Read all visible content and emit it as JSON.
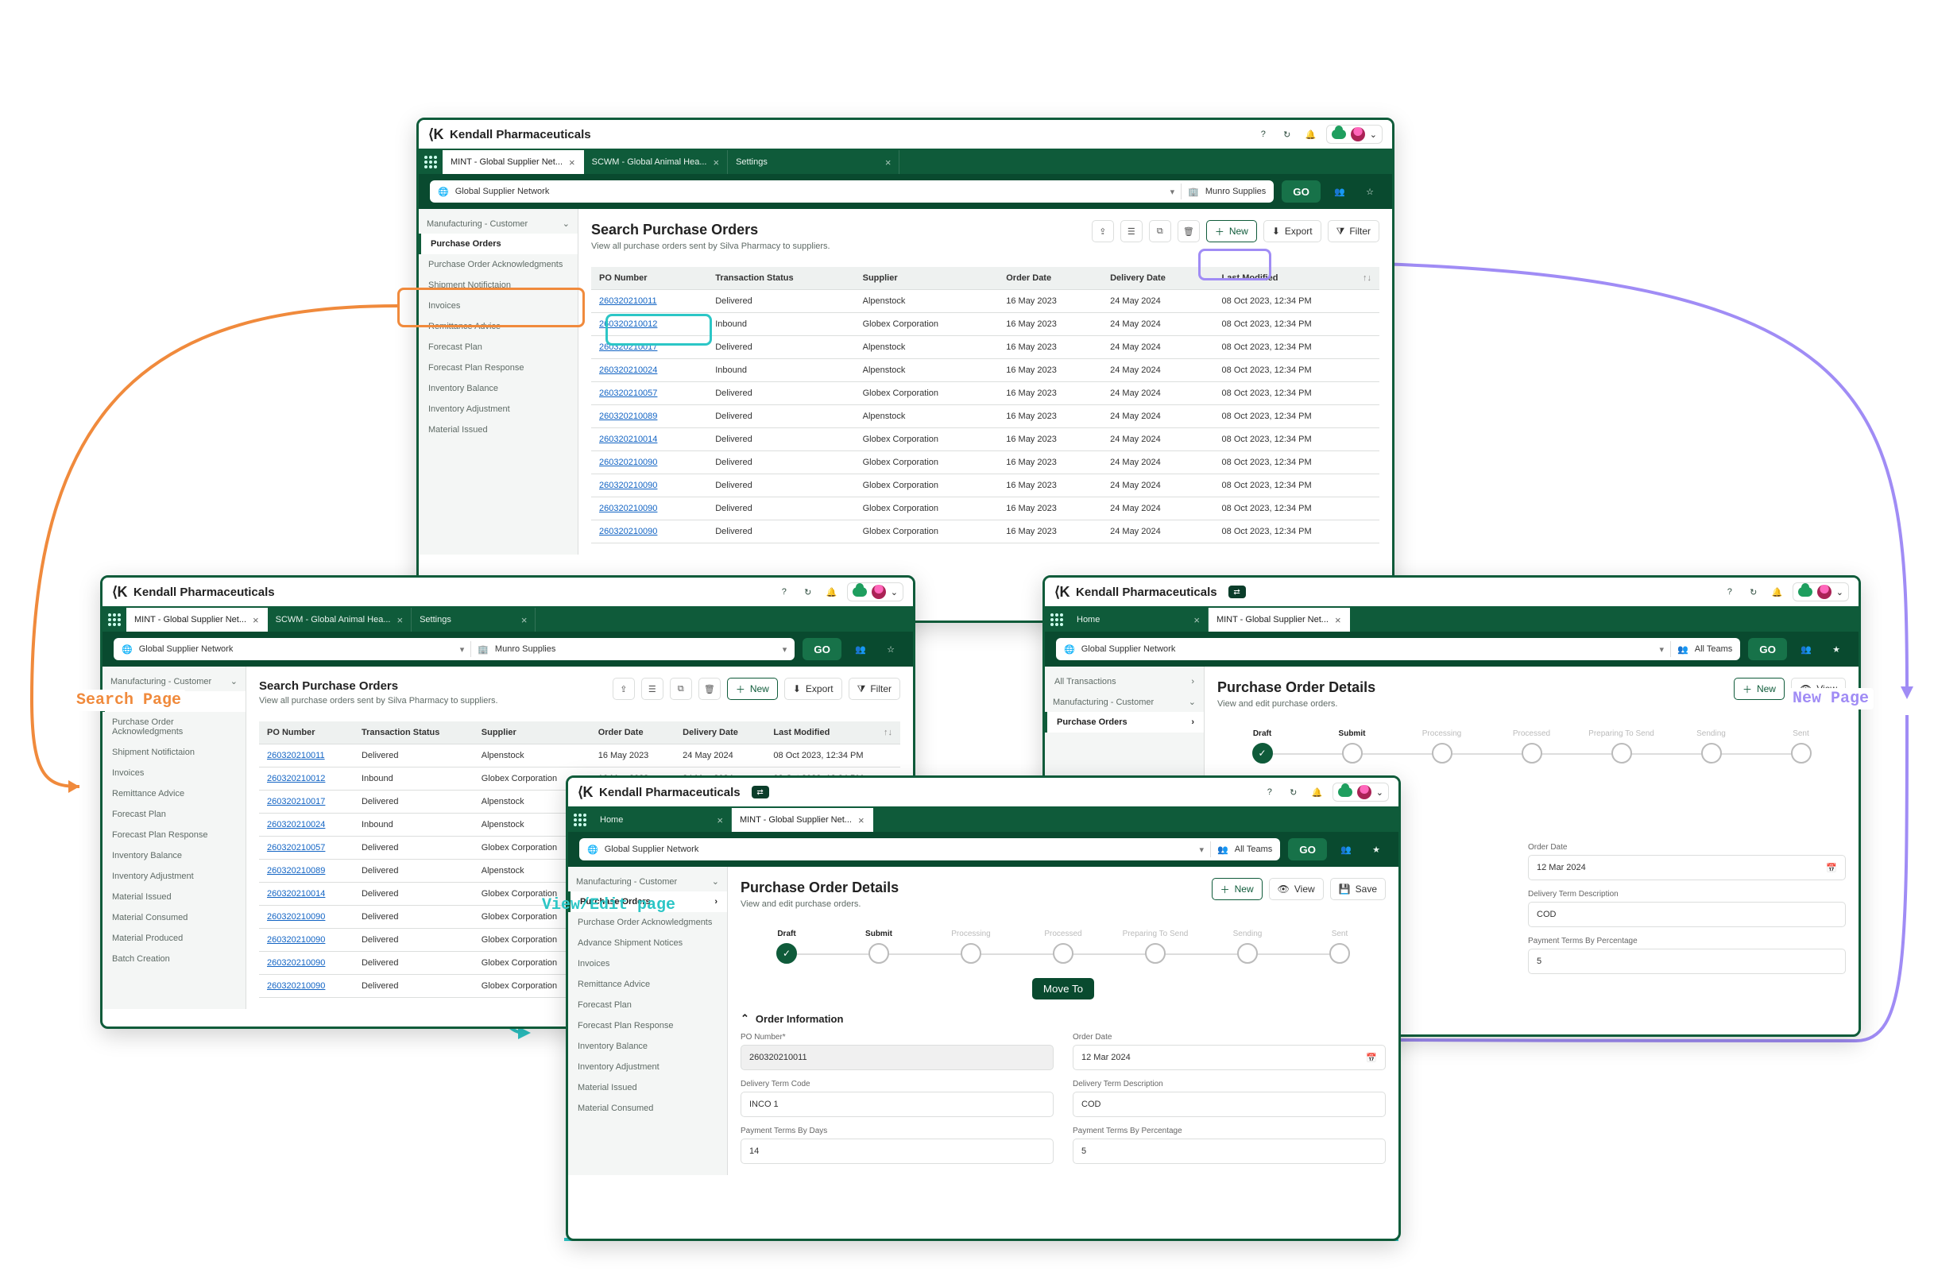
{
  "brand": "Kendall Pharmaceuticals",
  "header_icons": {
    "help": "?",
    "sync": "↻",
    "bell": "🔔"
  },
  "header_dropdown": "⌄",
  "go_label": "GO",
  "tabs": {
    "mint": "MINT - Global Supplier Net...",
    "scwm": "SCWM - Global Animal Hea...",
    "settings": "Settings",
    "home": "Home"
  },
  "context": {
    "scope": "Global Supplier Network",
    "supplier": "Munro Supplies",
    "all_teams": "All Teams"
  },
  "actions": {
    "new": "New",
    "export": "Export",
    "filter": "Filter",
    "view": "View",
    "save": "Save",
    "move_to": "Move To"
  },
  "search": {
    "title": "Search Purchase Orders",
    "subtitle": "View all purchase orders sent by Silva Pharmacy to suppliers.",
    "columns": [
      "PO Number",
      "Transaction Status",
      "Supplier",
      "Order Date",
      "Delivery Date",
      "Last Modified"
    ],
    "rows": [
      {
        "po": "260320210011",
        "status": "Delivered",
        "supplier": "Alpenstock",
        "order": "16 May 2023",
        "delivery": "24 May 2024",
        "modified": "08 Oct 2023, 12:34 PM"
      },
      {
        "po": "260320210012",
        "status": "Inbound",
        "supplier": "Globex Corporation",
        "order": "16 May 2023",
        "delivery": "24 May 2024",
        "modified": "08 Oct 2023, 12:34 PM"
      },
      {
        "po": "260320210017",
        "status": "Delivered",
        "supplier": "Alpenstock",
        "order": "16 May 2023",
        "delivery": "24 May 2024",
        "modified": "08 Oct 2023, 12:34 PM"
      },
      {
        "po": "260320210024",
        "status": "Inbound",
        "supplier": "Alpenstock",
        "order": "16 May 2023",
        "delivery": "24 May 2024",
        "modified": "08 Oct 2023, 12:34 PM"
      },
      {
        "po": "260320210057",
        "status": "Delivered",
        "supplier": "Globex Corporation",
        "order": "16 May 2023",
        "delivery": "24 May 2024",
        "modified": "08 Oct 2023, 12:34 PM"
      },
      {
        "po": "260320210089",
        "status": "Delivered",
        "supplier": "Alpenstock",
        "order": "16 May 2023",
        "delivery": "24 May 2024",
        "modified": "08 Oct 2023, 12:34 PM"
      },
      {
        "po": "260320210014",
        "status": "Delivered",
        "supplier": "Globex Corporation",
        "order": "16 May 2023",
        "delivery": "24 May 2024",
        "modified": "08 Oct 2023, 12:34 PM"
      },
      {
        "po": "260320210090",
        "status": "Delivered",
        "supplier": "Globex Corporation",
        "order": "16 May 2023",
        "delivery": "24 May 2024",
        "modified": "08 Oct 2023, 12:34 PM"
      },
      {
        "po": "260320210090",
        "status": "Delivered",
        "supplier": "Globex Corporation",
        "order": "16 May 2023",
        "delivery": "24 May 2024",
        "modified": "08 Oct 2023, 12:34 PM"
      },
      {
        "po": "260320210090",
        "status": "Delivered",
        "supplier": "Globex Corporation",
        "order": "16 May 2023",
        "delivery": "24 May 2024",
        "modified": "08 Oct 2023, 12:34 PM"
      },
      {
        "po": "260320210090",
        "status": "Delivered",
        "supplier": "Globex Corporation",
        "order": "16 May 2023",
        "delivery": "24 May 2024",
        "modified": "08 Oct 2023, 12:34 PM"
      }
    ]
  },
  "sidebar": {
    "header": "Manufacturing - Customer",
    "header_all": "All Transactions",
    "items": [
      "Purchase Orders",
      "Purchase Order Acknowledgments",
      "Shipment Notifictaion",
      "Invoices",
      "Remittance Advice",
      "Forecast Plan",
      "Forecast Plan Response",
      "Inventory Balance",
      "Inventory Adjustment",
      "Material Issued",
      "Material Consumed",
      "Material Produced",
      "Batch Creation"
    ],
    "items_detail": [
      "Purchase Orders",
      "Purchase Order Acknowledgments",
      "Advance Shipment Notices",
      "Invoices",
      "Remittance Advice",
      "Forecast Plan",
      "Forecast Plan Response",
      "Inventory Balance",
      "Inventory Adjustment",
      "Material Issued",
      "Material Consumed"
    ]
  },
  "details": {
    "title": "Purchase Order Details",
    "subtitle": "View and edit purchase orders.",
    "steps": [
      "Draft",
      "Submit",
      "Processing",
      "Processed",
      "Preparing To Send",
      "Sending",
      "Sent"
    ],
    "section_title": "Order Information",
    "fields": {
      "po_number_label": "PO Number*",
      "po_number": "260320210011",
      "order_date_label": "Order Date",
      "order_date": "12 Mar 2024",
      "dtc_label": "Delivery Term Code",
      "dtc": "INCO 1",
      "dtd_label": "Delivery Term Description",
      "dtd": "COD",
      "ptd_label": "Payment Terms By Days",
      "ptd": "14",
      "ptp_label": "Payment Terms By Percentage",
      "ptp": "5"
    }
  },
  "annotations": {
    "search": "Search Page",
    "view_edit": "View/Edit page",
    "new_page": "New Page"
  }
}
